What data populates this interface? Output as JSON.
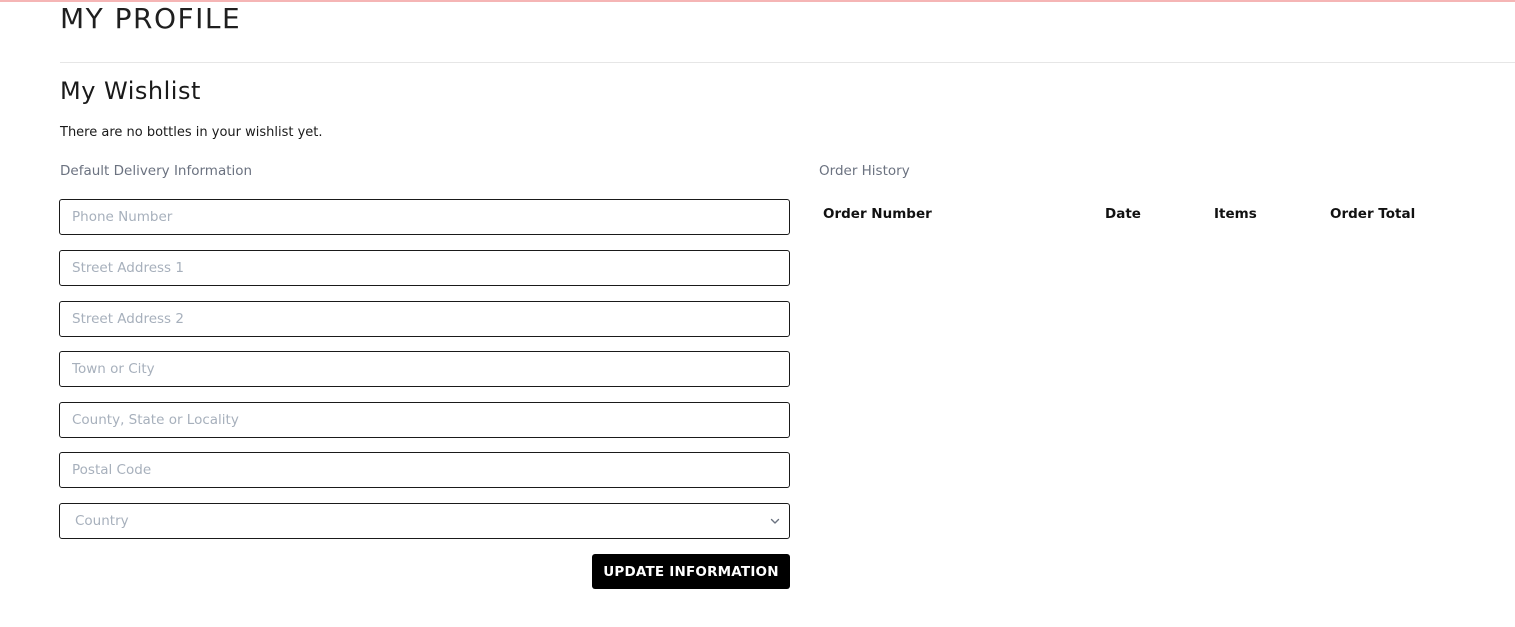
{
  "page": {
    "title": "MY PROFILE",
    "accent_color": "#f5b5b5"
  },
  "wishlist": {
    "title": "My Wishlist",
    "empty_message": "There are no bottles in your wishlist yet."
  },
  "delivery": {
    "label": "Default Delivery Information",
    "fields": {
      "phone": {
        "placeholder": "Phone Number",
        "value": ""
      },
      "street1": {
        "placeholder": "Street Address 1",
        "value": ""
      },
      "street2": {
        "placeholder": "Street Address 2",
        "value": ""
      },
      "town": {
        "placeholder": "Town or City",
        "value": ""
      },
      "county": {
        "placeholder": "County, State or Locality",
        "value": ""
      },
      "postal": {
        "placeholder": "Postal Code",
        "value": ""
      }
    },
    "country": {
      "selected": "Country",
      "icon": "chevron-down-icon"
    },
    "submit_label": "UPDATE INFORMATION"
  },
  "order_history": {
    "label": "Order History",
    "columns": [
      "Order Number",
      "Date",
      "Items",
      "Order Total"
    ],
    "rows": []
  }
}
